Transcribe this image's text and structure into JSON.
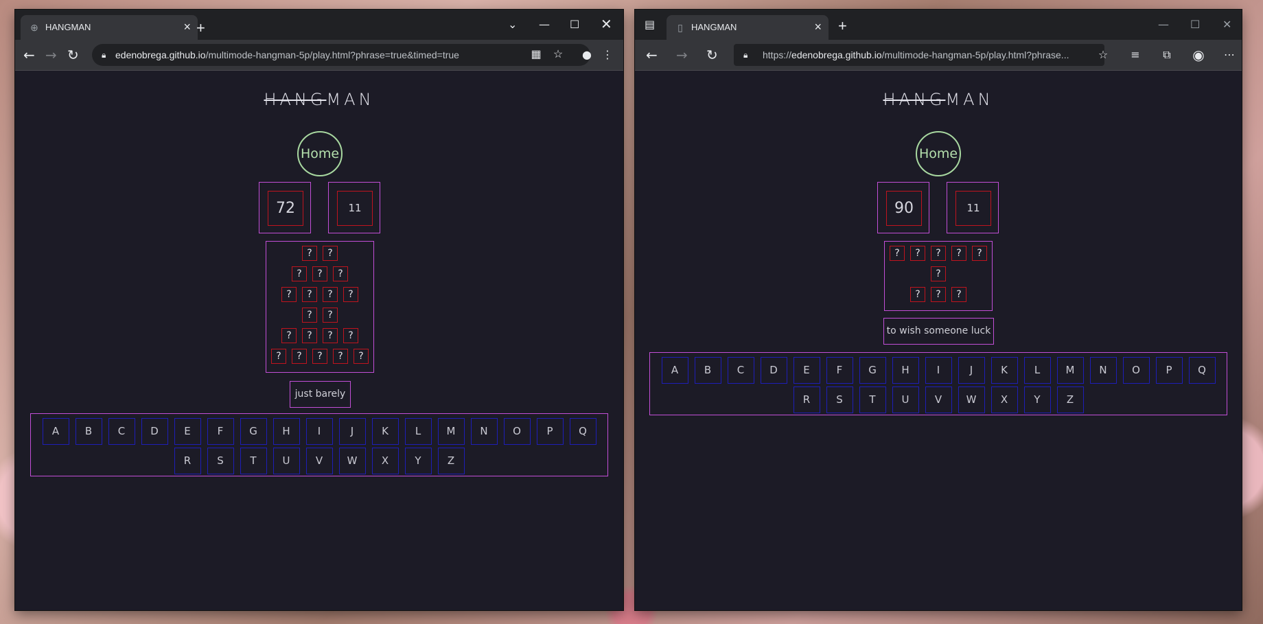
{
  "left_window": {
    "tab_title": "HANGMAN",
    "url_host": "edenobrega.github.io",
    "url_path": "/multimode-hangman-5p/play.html?phrase=true&timed=true",
    "game": {
      "logo_strike": "HANG",
      "logo_rest": "MAN",
      "home_label": "Home",
      "timer": "72",
      "lives": "11",
      "word_rows": [
        [
          "?",
          "?"
        ],
        [
          "?",
          "?",
          "?"
        ],
        [
          "?",
          "?",
          "?",
          "?"
        ],
        [
          "?",
          "?"
        ],
        [
          "?",
          "?",
          "?",
          "?"
        ],
        [
          "?",
          "?",
          "?",
          "?",
          "?"
        ]
      ],
      "hint": "just barely",
      "keys_row1": [
        "A",
        "B",
        "C",
        "D",
        "E",
        "F",
        "G",
        "H",
        "I",
        "J",
        "K",
        "L",
        "M",
        "N",
        "O",
        "P",
        "Q"
      ],
      "keys_row2": [
        "R",
        "S",
        "T",
        "U",
        "V",
        "W",
        "X",
        "Y",
        "Z"
      ]
    }
  },
  "right_window": {
    "tab_title": "HANGMAN",
    "url_scheme": "https://",
    "url_host": "edenobrega.github.io",
    "url_path": "/multimode-hangman-5p/play.html?phrase...",
    "game": {
      "logo_strike": "HANG",
      "logo_rest": "MAN",
      "home_label": "Home",
      "timer": "90",
      "lives": "11",
      "word_rows": [
        [
          "?",
          "?",
          "?",
          "?",
          "?"
        ],
        [
          "?"
        ],
        [
          "?",
          "?",
          "?"
        ]
      ],
      "hint": "to wish someone luck",
      "keys_row1": [
        "A",
        "B",
        "C",
        "D",
        "E",
        "F",
        "G",
        "H",
        "I",
        "J",
        "K",
        "L",
        "M",
        "N",
        "O",
        "P",
        "Q"
      ],
      "keys_row2": [
        "R",
        "S",
        "T",
        "U",
        "V",
        "W",
        "X",
        "Y",
        "Z"
      ]
    }
  },
  "icons": [
    "globe-icon",
    "page-icon",
    "close-icon",
    "plus-icon",
    "back-icon",
    "forward-icon",
    "reload-icon",
    "lock-icon",
    "star-icon",
    "profile-icon",
    "menu-icon",
    "minimize-icon",
    "maximize-icon",
    "chevron-down-icon",
    "sidebar-icon",
    "favorites-icon",
    "collections-icon",
    "qr-icon"
  ],
  "colors": {
    "page_bg": "#1c1b26",
    "box_border": "#c34fd8",
    "cell_border": "#c0141e",
    "key_border": "#1e1eb8",
    "home_border": "#a8d8a0"
  }
}
